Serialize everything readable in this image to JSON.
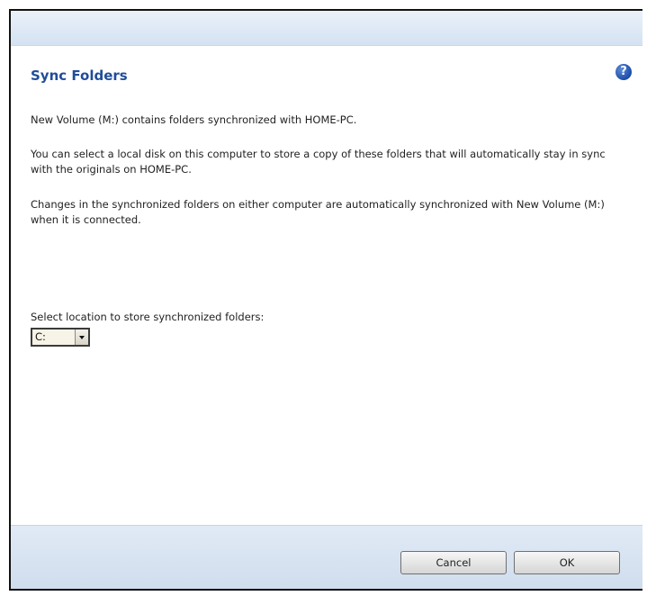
{
  "dialog": {
    "title": "Sync Folders",
    "help_icon": "question-mark-icon",
    "help_glyph": "?"
  },
  "body": {
    "paragraph_1": "New Volume (M:) contains folders synchronized with HOME-PC.",
    "paragraph_2": "You can select a local disk on this computer to store a copy of these folders that will automatically stay in sync with the originals on HOME-PC.",
    "paragraph_3": "Changes in the synchronized folders on either computer are automatically synchronized with New Volume (M:) when it is connected."
  },
  "location": {
    "label": "Select location to store synchronized folders:",
    "selected": "C:"
  },
  "footer": {
    "cancel_label": "Cancel",
    "ok_label": "OK"
  },
  "colors": {
    "title_text": "#1f4d99",
    "header_band": "#d5e2f2",
    "footer_band": "#d0dded"
  }
}
